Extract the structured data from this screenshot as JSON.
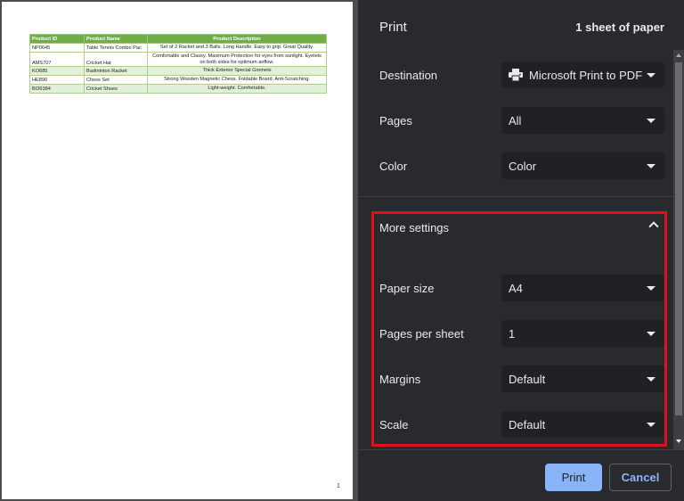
{
  "preview": {
    "table": {
      "headers": [
        "Product ID",
        "Product Name",
        "Product Description"
      ],
      "rows": [
        [
          "NP0645",
          "Table Tennis Combo Pac",
          "Set of 2 Racket and 3 Balls. Long Handle. Easy to grip. Great Quality."
        ],
        [
          "AMS707",
          "Cricket Hat",
          "Comfortable and Classy. Maximum Protection for eyes from sunlight. Eyelets on both sides for optimum airflow."
        ],
        [
          "KO685",
          "Badminton Racket",
          "Thick Exterior Special Gromets"
        ],
        [
          "HE890",
          "Chess Set",
          "Strong Wooden Magnetic Chess. Foldable Board. Anti-Scratching."
        ],
        [
          "BI36384",
          "Cricket Shoes",
          "Light-weight. Comfortable."
        ]
      ]
    },
    "page_number": "1"
  },
  "panel": {
    "title": "Print",
    "sheet_count": "1 sheet of paper",
    "destination": {
      "label": "Destination",
      "value": "Microsoft Print to PDF",
      "icon": "printer-icon"
    },
    "pages": {
      "label": "Pages",
      "value": "All"
    },
    "color": {
      "label": "Color",
      "value": "Color"
    },
    "more_settings": {
      "label": "More settings",
      "expanded": true,
      "highlight_color": "#e01020"
    },
    "paper_size": {
      "label": "Paper size",
      "value": "A4"
    },
    "pages_per_sheet": {
      "label": "Pages per sheet",
      "value": "1"
    },
    "margins": {
      "label": "Margins",
      "value": "Default"
    },
    "scale": {
      "label": "Scale",
      "value": "Default"
    },
    "buttons": {
      "print": "Print",
      "cancel": "Cancel"
    },
    "colors": {
      "accent": "#8ab4f8",
      "background": "#292a2d",
      "field": "#202124"
    }
  }
}
